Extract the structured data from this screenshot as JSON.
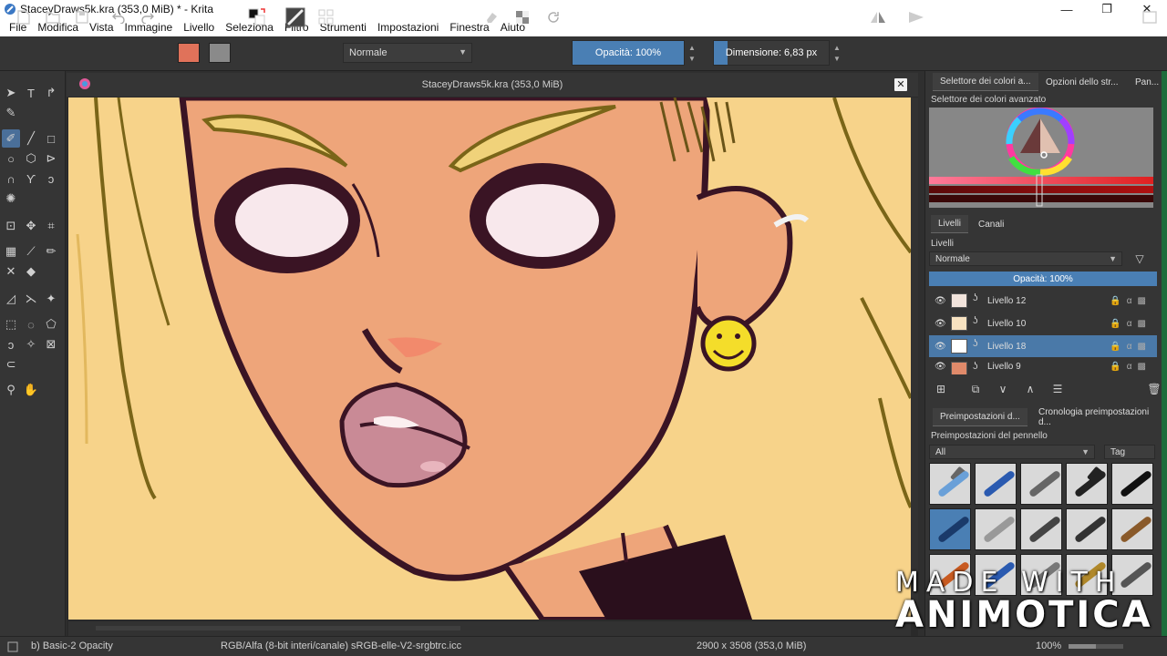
{
  "window": {
    "title": "StaceyDraws5k.kra (353,0 MiB) * - Krita"
  },
  "menu": [
    "File",
    "Modifica",
    "Vista",
    "Immagine",
    "Livello",
    "Seleziona",
    "Filtro",
    "Strumenti",
    "Impostazioni",
    "Finestra",
    "Aiuto"
  ],
  "tool_options": {
    "blend_mode": "Normale",
    "opacity_label": "Opacità: 100%",
    "opacity_value": 1.0,
    "size_label": "Dimensione: 6,83 px",
    "size_value": 0.12,
    "fg_color": "#e0725a",
    "bg_color": "#8a8a8a"
  },
  "document": {
    "tab_title": "StaceyDraws5k.kra (353,0 MiB)"
  },
  "docker": {
    "tabs": [
      "Selettore dei colori a...",
      "Opzioni dello str...",
      "Pan..."
    ],
    "color_selector_title": "Selettore dei colori avanzato",
    "layer_tabs": [
      "Livelli",
      "Canali"
    ],
    "layers_title": "Livelli",
    "layers_blend_mode": "Normale",
    "layers_opacity": "Opacità:  100%",
    "layers": [
      {
        "name": "Livello 12",
        "selected": false
      },
      {
        "name": "Livello 10",
        "selected": false
      },
      {
        "name": "Livello 18",
        "selected": true
      },
      {
        "name": "Livello 9",
        "selected": false
      }
    ],
    "presets_tabs": [
      "Preimpostazioni d...",
      "Cronologia preimpostazioni d..."
    ],
    "presets_title": "Preimpostazioni del pennello",
    "presets_filter": "All",
    "presets_tag": "Tag"
  },
  "status": {
    "brush": "b) Basic-2 Opacity",
    "color_model": "RGB/Alfa (8-bit interi/canale)  sRGB-elle-V2-srgbtrc.icc",
    "image_size": "2900 x 3508 (353,0 MiB)",
    "zoom": "100%"
  },
  "watermark": {
    "line1": "MADE WITH",
    "line2": "ANIMOTICA"
  },
  "colors": {
    "accent": "#4a7fb4",
    "skin": "#eea57a",
    "hair": "#f7d38a",
    "outline": "#3a1424"
  }
}
